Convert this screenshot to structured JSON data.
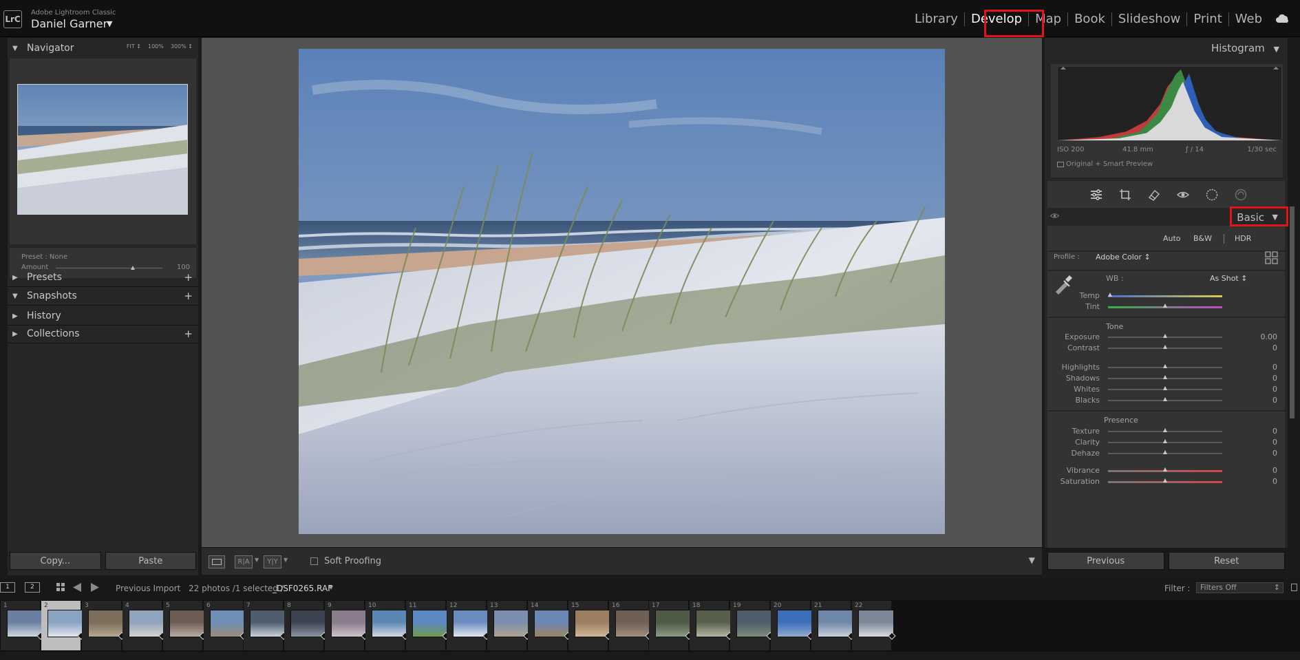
{
  "header": {
    "app_name": "Adobe Lightroom Classic",
    "user_name": "Daniel Garner",
    "logo_text": "LrC",
    "modules": [
      "Library",
      "Develop",
      "Map",
      "Book",
      "Slideshow",
      "Print",
      "Web"
    ],
    "active_module": "Develop",
    "highlight_color": "#e2141a"
  },
  "left_panel": {
    "navigator": {
      "title": "Navigator",
      "zoom": [
        "FIT ↕",
        "100%",
        "300% ↕"
      ]
    },
    "preset": {
      "label": "Preset : None",
      "amount_label": "Amount",
      "amount_value": "100",
      "amount_fraction": 0.72
    },
    "sections": [
      {
        "title": "Presets",
        "expanded": false,
        "has_add": true
      },
      {
        "title": "Snapshots",
        "expanded": true,
        "has_add": true
      },
      {
        "title": "History",
        "expanded": false,
        "has_add": false
      },
      {
        "title": "Collections",
        "expanded": false,
        "has_add": true
      }
    ],
    "buttons": {
      "copy": "Copy...",
      "paste": "Paste"
    }
  },
  "toolbar": {
    "ra_label": "R|A",
    "yy_label": "Y|Y",
    "soft_proofing": "Soft Proofing",
    "soft_proofing_checked": false
  },
  "right_panel": {
    "histogram": {
      "title": "Histogram",
      "iso": "ISO 200",
      "focal": "41.8 mm",
      "aperture": "ƒ / 14",
      "shutter": "1/30 sec",
      "preview": "Original + Smart Preview"
    },
    "tools": [
      "sliders-icon",
      "crop-icon",
      "heal-icon",
      "redeye-icon",
      "mask-icon",
      "radial-icon"
    ],
    "basic": {
      "title": "Basic",
      "modes": [
        "Auto",
        "B&W",
        "HDR"
      ],
      "profile_label": "Profile :",
      "profile_value": "Adobe Color ↕",
      "wb_label": "WB :",
      "wb_value": "As Shot ↕",
      "tone_title": "Tone",
      "presence_title": "Presence",
      "wb_sliders": [
        {
          "label": "Temp",
          "position": 0.02,
          "value": ""
        },
        {
          "label": "Tint",
          "position": 0.5,
          "value": ""
        }
      ],
      "tone_sliders": [
        {
          "label": "Exposure",
          "position": 0.5,
          "value": "0.00"
        },
        {
          "label": "Contrast",
          "position": 0.5,
          "value": "0"
        },
        {
          "label": "Highlights",
          "position": 0.5,
          "value": "0"
        },
        {
          "label": "Shadows",
          "position": 0.5,
          "value": "0"
        },
        {
          "label": "Whites",
          "position": 0.5,
          "value": "0"
        },
        {
          "label": "Blacks",
          "position": 0.5,
          "value": "0"
        }
      ],
      "presence_sliders": [
        {
          "label": "Texture",
          "position": 0.5,
          "value": "0"
        },
        {
          "label": "Clarity",
          "position": 0.5,
          "value": "0"
        },
        {
          "label": "Dehaze",
          "position": 0.5,
          "value": "0"
        },
        {
          "label": "Vibrance",
          "position": 0.5,
          "value": "0"
        },
        {
          "label": "Saturation",
          "position": 0.5,
          "value": "0"
        }
      ]
    },
    "buttons": {
      "previous": "Previous",
      "reset": "Reset"
    }
  },
  "filmstrip": {
    "screen1": "1",
    "screen2": "2",
    "source": "Previous Import",
    "count": "22 photos /1 selected /",
    "filename": "_DSF0265.RAF",
    "filter_label": "Filter :",
    "filter_value": "Filters Off",
    "selected_index": 2,
    "frames": [
      "1",
      "2",
      "3",
      "4",
      "5",
      "6",
      "7",
      "8",
      "9",
      "10",
      "11",
      "12",
      "13",
      "14",
      "15",
      "16",
      "17",
      "18",
      "19",
      "20",
      "21",
      "22"
    ]
  }
}
